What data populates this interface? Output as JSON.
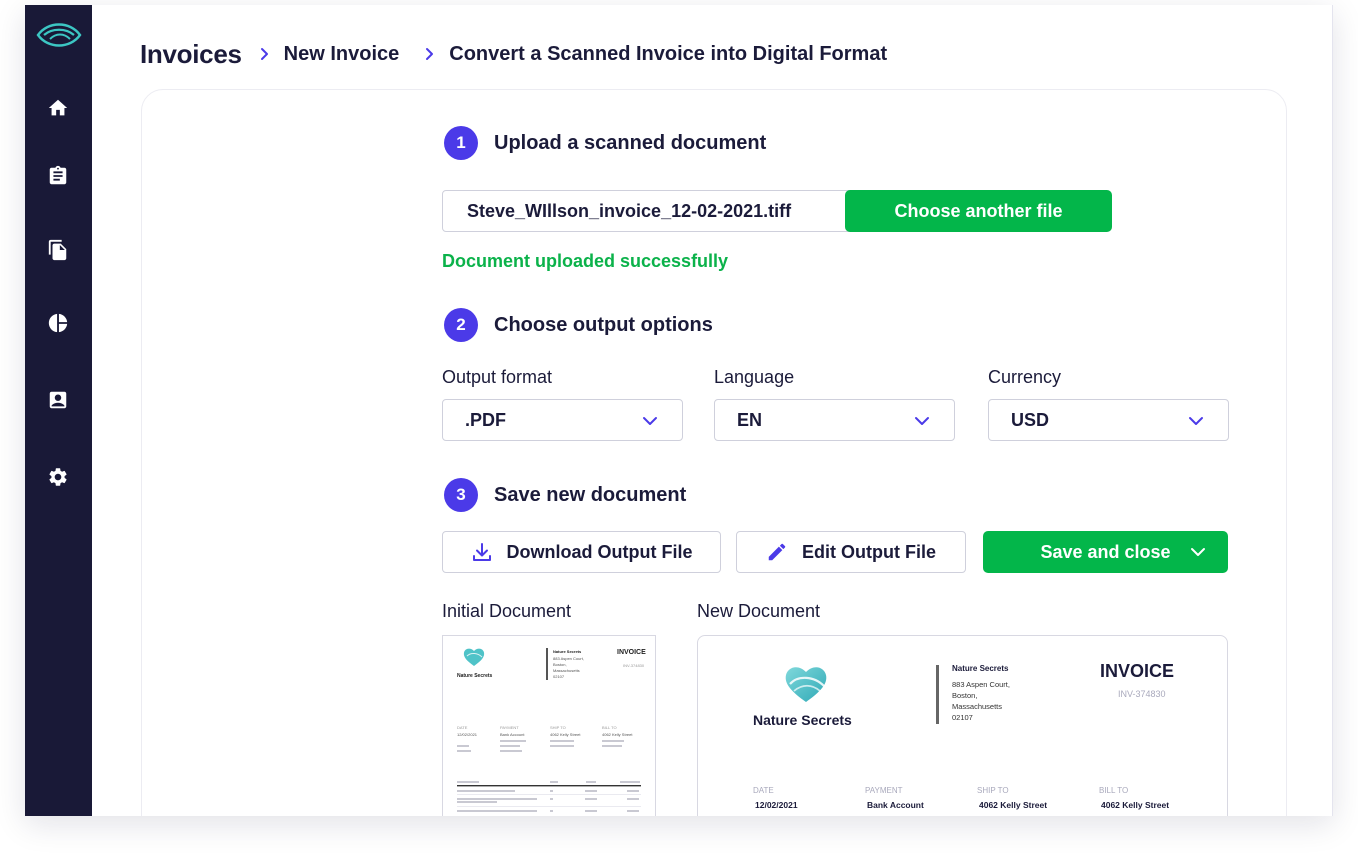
{
  "breadcrumb": {
    "root": "Invoices",
    "level1": "New Invoice",
    "level2": "Convert a Scanned Invoice into Digital Format"
  },
  "sidebar": {
    "items": [
      {
        "icon": "home-icon"
      },
      {
        "icon": "clipboard-icon"
      },
      {
        "icon": "documents-icon"
      },
      {
        "icon": "pie-chart-icon"
      },
      {
        "icon": "contact-icon"
      },
      {
        "icon": "gear-icon"
      }
    ]
  },
  "step1": {
    "number": "1",
    "title": "Upload a scanned document",
    "file_name": "Steve_WIllson_invoice_12-02-2021.tiff",
    "choose_label": "Choose another file",
    "status": "Document uploaded successfully"
  },
  "step2": {
    "number": "2",
    "title": "Choose output options",
    "format_label": "Output format",
    "format_value": ".PDF",
    "language_label": "Language",
    "language_value": "EN",
    "currency_label": "Currency",
    "currency_value": "USD"
  },
  "step3": {
    "number": "3",
    "title": "Save new document",
    "download_label": "Download Output File",
    "edit_label": "Edit Output File",
    "save_label": "Save and close"
  },
  "preview": {
    "initial_label": "Initial Document",
    "new_label": "New Document",
    "company": "Nature Secrets",
    "address": [
      "883 Aspen Court,",
      "Boston,",
      "Massachusetts",
      "02107"
    ],
    "invoice_title": "INVOICE",
    "invoice_number": "INV-374830",
    "columns": [
      "DATE",
      "PAYMENT",
      "SHIP TO",
      "BILL TO"
    ],
    "values": [
      "12/02/2021",
      "Bank Account",
      "4062 Kelly Street",
      "4062 Kelly Street"
    ]
  },
  "colors": {
    "sidebar": "#191937",
    "accent": "#4b3ae8",
    "green": "#03b64a",
    "teal": "#3cc6c3"
  }
}
